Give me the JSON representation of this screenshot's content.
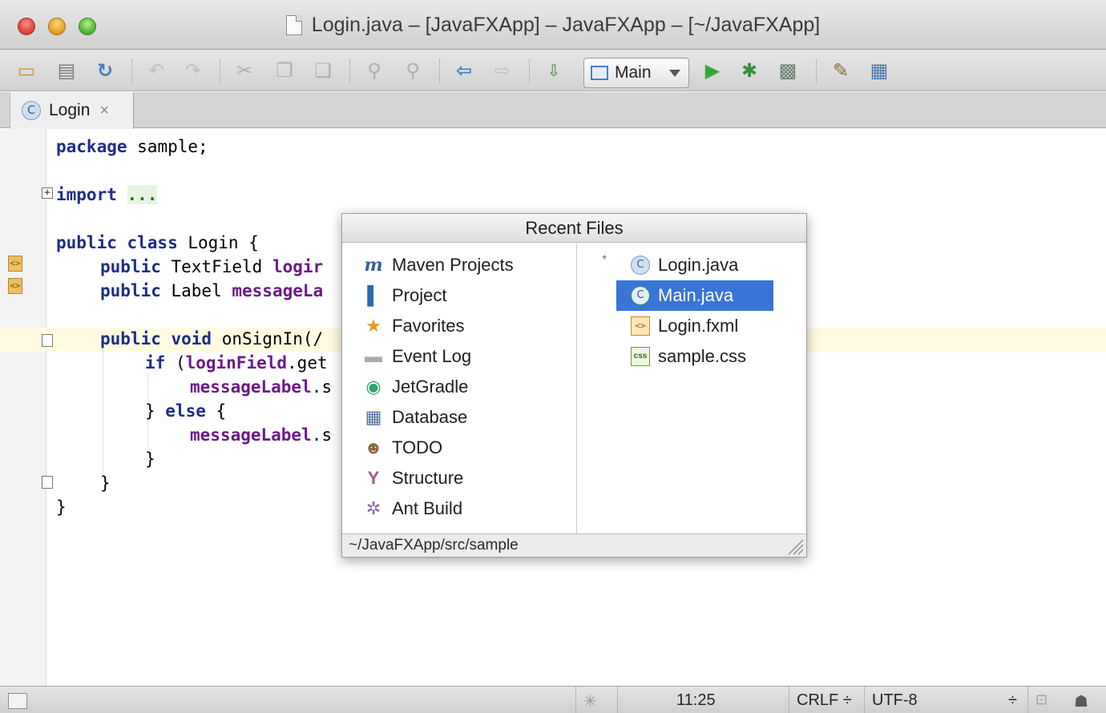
{
  "window": {
    "title": "Login.java – [JavaFXApp] – JavaFXApp – [~/JavaFXApp]"
  },
  "toolbar": {
    "run_config_label": "Main",
    "icons": [
      "open-folder-icon",
      "save-icon",
      "sync-icon",
      "undo-icon",
      "redo-icon",
      "cut-icon",
      "copy-icon",
      "paste-icon",
      "find-icon",
      "replace-icon",
      "back-icon",
      "forward-icon",
      "make-project-icon",
      "run-icon",
      "debug-icon",
      "coverage-icon",
      "settings-icon",
      "project-structure-icon"
    ]
  },
  "tabs": [
    {
      "label": "Login",
      "badge": "C",
      "close": "×"
    }
  ],
  "editor": {
    "lines": {
      "l1_kw": "package",
      "l1_rest": " sample;",
      "l2_kw": "import",
      "l2_dots": "...",
      "l3_kw": "public class",
      "l3_rest": " Login {",
      "l4_kw": "public",
      "l4_type": " TextField ",
      "l4_field": "logir",
      "l5_kw": "public",
      "l5_type": " Label ",
      "l5_field": "messageLa",
      "l6_kw": "public void",
      "l6_rest": " onSignIn(/",
      "l7_kw": "if",
      "l7_paren": " (",
      "l7_field": "loginField",
      "l7_rest": ".get",
      "l8_field": "messageLabel",
      "l8_rest": ".s",
      "l9_pre": "} ",
      "l9_kw": "else",
      "l9_rest": " {",
      "l10_field": "messageLabel",
      "l10_rest": ".s",
      "l11": "}",
      "l12": "}",
      "l13": "}"
    }
  },
  "popup": {
    "title": "Recent Files",
    "tool_windows": [
      {
        "label": "Maven Projects",
        "icon": "maven-icon",
        "glyph": "m"
      },
      {
        "label": "Project",
        "icon": "project-icon",
        "glyph": "▌"
      },
      {
        "label": "Favorites",
        "icon": "favorites-star-icon",
        "glyph": "★"
      },
      {
        "label": "Event Log",
        "icon": "event-log-icon",
        "glyph": "▬"
      },
      {
        "label": "JetGradle",
        "icon": "jetgradle-icon",
        "glyph": "◉"
      },
      {
        "label": "Database",
        "icon": "database-icon",
        "glyph": "▦"
      },
      {
        "label": "TODO",
        "icon": "todo-icon",
        "glyph": "☻"
      },
      {
        "label": "Structure",
        "icon": "structure-icon",
        "glyph": "Y"
      },
      {
        "label": "Ant Build",
        "icon": "ant-build-icon",
        "glyph": "✲"
      }
    ],
    "files": [
      {
        "label": "Login.java",
        "icon": "java-class-icon",
        "glyph": "C",
        "modified": "*"
      },
      {
        "label": "Main.java",
        "icon": "java-main-class-icon",
        "glyph": "C",
        "selected": true
      },
      {
        "label": "Login.fxml",
        "icon": "fxml-file-icon",
        "glyph": "<>"
      },
      {
        "label": "sample.css",
        "icon": "css-file-icon",
        "glyph": "css"
      }
    ],
    "footer_path": "~/JavaFXApp/src/sample"
  },
  "statusbar": {
    "position": "11:25",
    "line_separator": "CRLF ÷",
    "encoding": "UTF-8",
    "encoding_arrow": "÷"
  },
  "colors": {
    "keyword": "#1d2d8a",
    "field": "#6b1a8a",
    "selection": "#3875d7",
    "current_line": "#fffbe0"
  }
}
